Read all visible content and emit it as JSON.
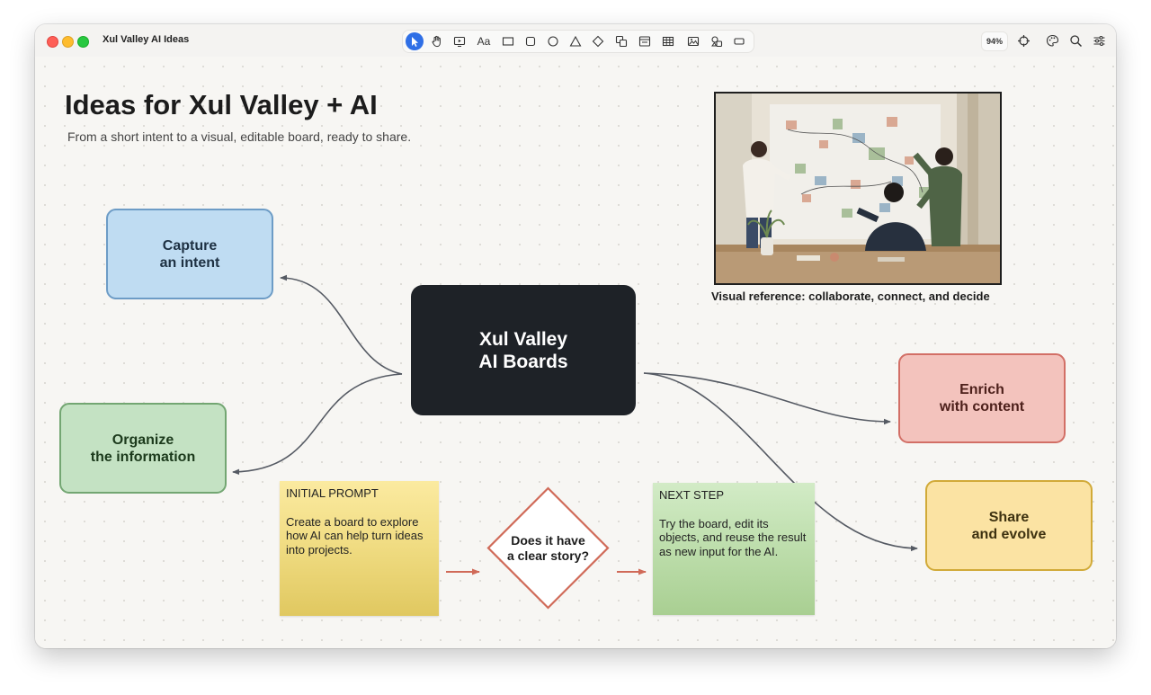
{
  "window": {
    "title": "Xul Valley AI Ideas",
    "zoom": "94%"
  },
  "toolbar": {
    "tools": [
      "select-icon",
      "hand-icon",
      "present-icon",
      "text-icon",
      "rectangle-icon",
      "rounded-rectangle-icon",
      "ellipse-icon",
      "triangle-icon",
      "diamond-icon",
      "shapes-icon",
      "card-icon",
      "table-icon",
      "image-icon",
      "stickers-icon",
      "frame-icon"
    ],
    "text_tool_label": "Aa",
    "right_icons": [
      "target-icon",
      "palette-icon",
      "search-icon",
      "settings-icon"
    ]
  },
  "board": {
    "title": "Ideas for Xul Valley + AI",
    "subtitle": "From a short intent to a visual, editable board, ready to share.",
    "image_caption": "Visual reference: collaborate, connect, and decide",
    "center_node": "Xul Valley\nAI Boards",
    "nodes": {
      "capture": "Capture\nan intent",
      "organize": "Organize\nthe information",
      "enrich": "Enrich\nwith content",
      "share": "Share\nand evolve"
    },
    "sticky_prompt": {
      "title": "INITIAL PROMPT",
      "body": "Create a board to explore how AI can help turn ideas into projects."
    },
    "decision": "Does it have\na clear story?",
    "sticky_next": {
      "title": "NEXT STEP",
      "body": "Try the board, edit its objects, and reuse the result as new input for the AI."
    }
  },
  "colors": {
    "accent": "#2f6fe6",
    "center_node": "#1e2227",
    "capture": "#bfdcf2",
    "organize": "#c4e2c3",
    "enrich": "#f3c3bd",
    "share": "#fbe3a3",
    "flow_arrow": "#d06a58",
    "connector": "#555a63"
  }
}
